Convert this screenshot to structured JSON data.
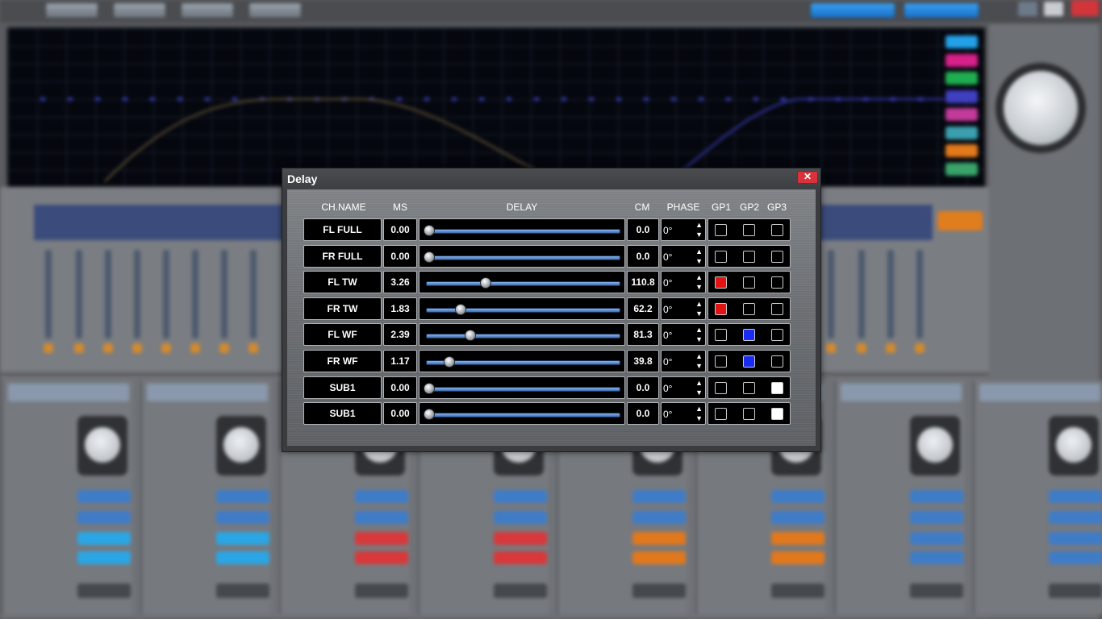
{
  "dialog": {
    "title": "Delay",
    "close_glyph": "✕",
    "columns": {
      "name": "CH.NAME",
      "ms": "MS",
      "delay": "DELAY",
      "cm": "CM",
      "phase": "PHASE",
      "gp1": "GP1",
      "gp2": "GP2",
      "gp3": "GP3"
    },
    "max_delay_ms": 11.0,
    "group_colors": {
      "gp1": "#e31313",
      "gp2": "#1a2cf0",
      "gp3": "#ffffff",
      "off": "#000000"
    },
    "rows": [
      {
        "name": "FL FULL",
        "ms": "0.00",
        "cm": "0.0",
        "phase": "0°",
        "gp1": false,
        "gp2": false,
        "gp3": false
      },
      {
        "name": "FR FULL",
        "ms": "0.00",
        "cm": "0.0",
        "phase": "0°",
        "gp1": false,
        "gp2": false,
        "gp3": false
      },
      {
        "name": "FL TW",
        "ms": "3.26",
        "cm": "110.8",
        "phase": "0°",
        "gp1": true,
        "gp2": false,
        "gp3": false
      },
      {
        "name": "FR TW",
        "ms": "1.83",
        "cm": "62.2",
        "phase": "0°",
        "gp1": true,
        "gp2": false,
        "gp3": false
      },
      {
        "name": "FL WF",
        "ms": "2.39",
        "cm": "81.3",
        "phase": "0°",
        "gp1": false,
        "gp2": true,
        "gp3": false
      },
      {
        "name": "FR WF",
        "ms": "1.17",
        "cm": "39.8",
        "phase": "0°",
        "gp1": false,
        "gp2": true,
        "gp3": false
      },
      {
        "name": "SUB1",
        "ms": "0.00",
        "cm": "0.0",
        "phase": "0°",
        "gp1": false,
        "gp2": false,
        "gp3": true
      },
      {
        "name": "SUB1",
        "ms": "0.00",
        "cm": "0.0",
        "phase": "0°",
        "gp1": false,
        "gp2": false,
        "gp3": true
      }
    ]
  },
  "background": {
    "eq_channel_colors": [
      "#22a0e8",
      "#d8208a",
      "#1fae4f",
      "#3f3fc0",
      "#c23a9a",
      "#3b9fae",
      "#e2791b",
      "#3aa36a"
    ]
  }
}
